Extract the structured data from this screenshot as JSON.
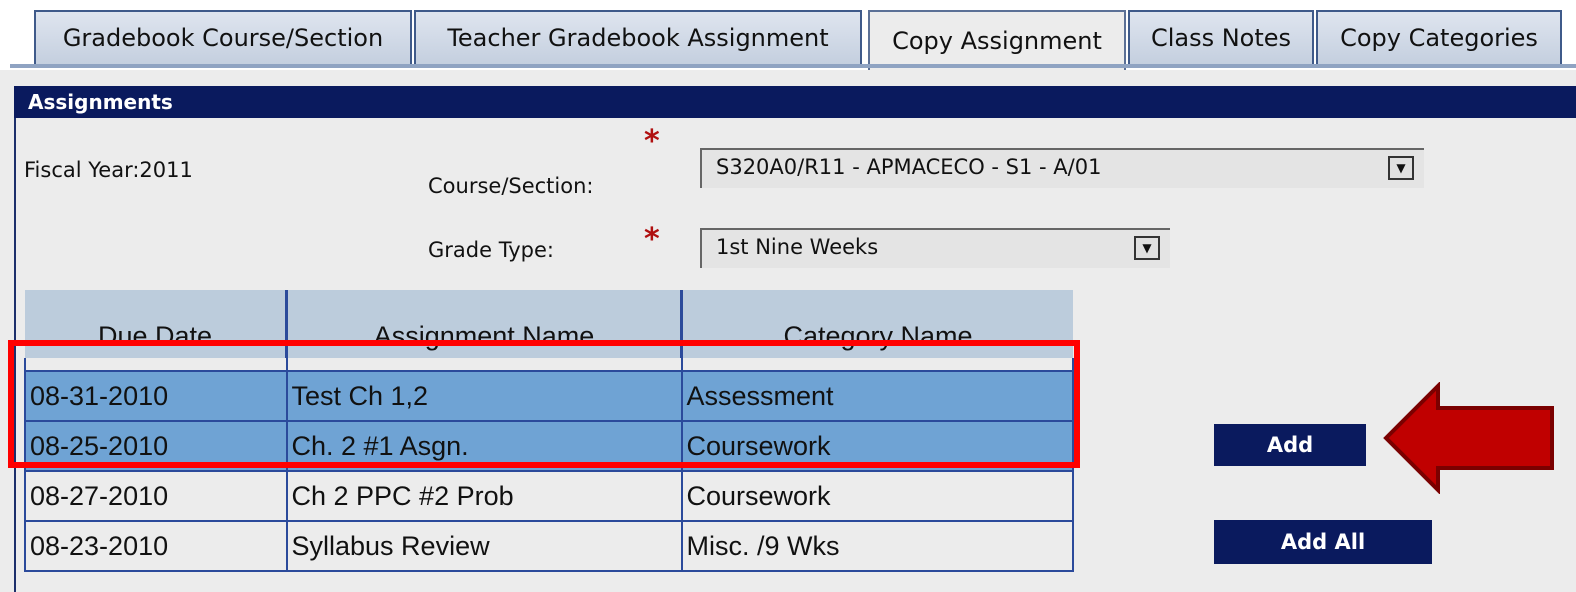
{
  "tabs": [
    {
      "label": "Gradebook Course/Section"
    },
    {
      "label": "Teacher Gradebook Assignment"
    },
    {
      "label": "Copy Assignment",
      "active": true
    },
    {
      "label": "Class Notes"
    },
    {
      "label": "Copy Categories"
    }
  ],
  "panel": {
    "title": "Assignments",
    "fiscal_year": "Fiscal Year:2011",
    "required_marker": "*",
    "course_section": {
      "label": "Course/Section:",
      "value": "S320A0/R11 - APMACECO - S1 - A/01"
    },
    "grade_type": {
      "label": "Grade Type:",
      "value": "1st Nine Weeks"
    }
  },
  "table": {
    "headers": [
      "Due Date",
      "Assignment Name",
      "Category Name"
    ],
    "rows": [
      {
        "due": "08-31-2010",
        "name": "Test Ch 1,2",
        "category": "Assessment",
        "selected": true
      },
      {
        "due": "08-25-2010",
        "name": "Ch. 2 #1 Asgn.",
        "category": "Coursework",
        "selected": true
      },
      {
        "due": "08-27-2010",
        "name": "Ch 2 PPC #2 Prob",
        "category": "Coursework",
        "selected": false
      },
      {
        "due": "08-23-2010",
        "name": "Syllabus Review",
        "category": "Misc. /9 Wks",
        "selected": false
      }
    ]
  },
  "buttons": {
    "add": "Add",
    "add_all": "Add All"
  },
  "icons": {
    "dropdown": "chevron-down-icon",
    "pointer": "red-arrow-icon"
  },
  "colors": {
    "header_bg": "#0a1a5e",
    "selected_row": "#6fa3d4",
    "highlight": "#ff0000",
    "arrow": "#c00000"
  }
}
